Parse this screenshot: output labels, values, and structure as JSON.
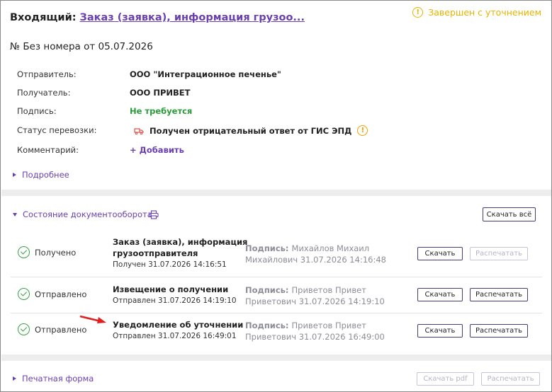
{
  "header": {
    "label": "Входящий:",
    "title": "Заказ (заявка), информация грузоо...",
    "status": "Завершен с уточнением"
  },
  "doc_number": "№ Без номера от 05.07.2026",
  "fields": {
    "sender_label": "Отправитель:",
    "sender_value": "ООО \"Интеграционное печенье\"",
    "receiver_label": "Получатель:",
    "receiver_value": "ООО ПРИВЕТ",
    "signature_label": "Подпись:",
    "signature_value": "Не требуется",
    "transport_label": "Статус перевозки:",
    "transport_value": "Получен отрицательный ответ от ГИС ЭПД",
    "comment_label": "Комментарий:",
    "comment_action": "+ Добавить"
  },
  "more_label": "Подробнее",
  "workflow": {
    "title": "Состояние документооборота",
    "download_all": "Скачать всё",
    "rows": [
      {
        "status": "Получено",
        "title_line1": "Заказ (заявка), информация",
        "title_line2": "грузоотправителя",
        "sub": "Получен 31.07.2026 14:16:51",
        "sign_label": "Подпись:",
        "sign_line1": "Михайлов Михаил",
        "sign_line2": "Михайлович 31.07.2026 14:16:48",
        "download": "Скачать",
        "print": "Распечатать",
        "print_disabled": true
      },
      {
        "status": "Отправлено",
        "title_line1": "Извещение о получении",
        "title_line2": "",
        "sub": "Отправлен 31.07.2026 14:19:10",
        "sign_label": "Подпись:",
        "sign_line1": "Приветов Привет",
        "sign_line2": "Приветович 31.07.2026 14:19:10",
        "download": "Скачать",
        "print": "Распечатать",
        "print_disabled": false
      },
      {
        "status": "Отправлено",
        "title_line1": "Уведомление об уточнении",
        "title_line2": "",
        "sub": "Отправлен 31.07.2026 16:49:01",
        "sign_label": "Подпись:",
        "sign_line1": "Приветов Привет",
        "sign_line2": "Приветович 31.07.2026 16:49:00",
        "download": "Скачать",
        "print": "Распечатать",
        "print_disabled": false
      }
    ]
  },
  "print_form": {
    "label": "Печатная форма",
    "download_pdf": "Скачать pdf",
    "print": "Распечатать"
  },
  "colors": {
    "accent": "#6a3fb0",
    "warning": "#e6b400",
    "success": "#3aa04a",
    "arrow": "#e02020"
  }
}
